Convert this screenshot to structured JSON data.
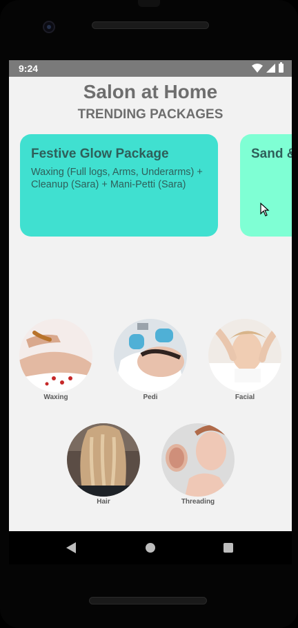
{
  "status_bar": {
    "time": "9:24"
  },
  "header": {
    "title": "Salon at Home",
    "subtitle": "TRENDING PACKAGES"
  },
  "packages": [
    {
      "title": "Festive Glow Package",
      "description": "Waxing (Full logs, Arms, Underarms) + Cleanup (Sara) + Mani-Petti (Sara)",
      "color": "#40e0d0"
    },
    {
      "title": "Sand & Sun Package",
      "description": "",
      "color": "#7fffd4"
    }
  ],
  "services": [
    {
      "label": "Waxing"
    },
    {
      "label": "Pedi"
    },
    {
      "label": "Facial"
    },
    {
      "label": "Hair"
    },
    {
      "label": "Threading"
    }
  ]
}
